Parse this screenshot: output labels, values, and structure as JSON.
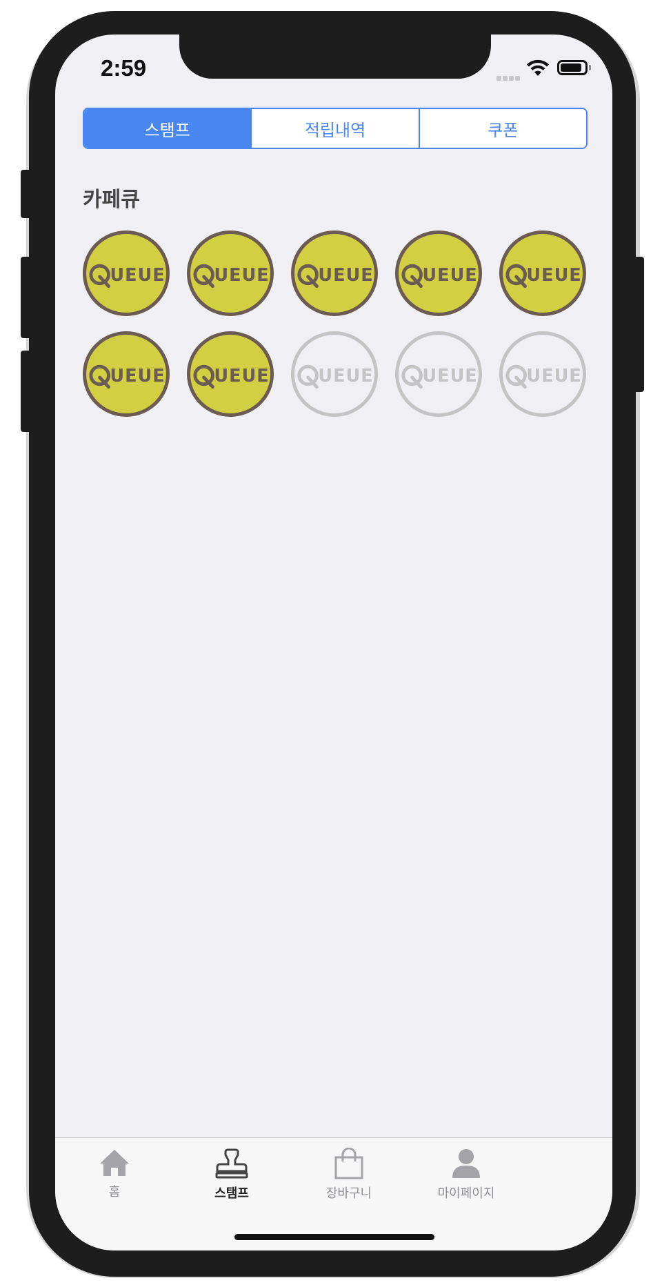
{
  "status_bar": {
    "time": "2:59"
  },
  "segmented": {
    "tabs": [
      {
        "label": "스탬프",
        "active": true
      },
      {
        "label": "적립내역",
        "active": false
      },
      {
        "label": "쿠폰",
        "active": false
      }
    ]
  },
  "store": {
    "name": "카페큐"
  },
  "stamps": {
    "logo_text": "QUEUE",
    "total": 10,
    "collected": 7,
    "filled_color": "#d2cf42",
    "outline_color": "#6b5b52",
    "empty_color": "#c4c4c4"
  },
  "tabbar": {
    "items": [
      {
        "label": "홈",
        "icon": "home-icon"
      },
      {
        "label": "스탬프",
        "icon": "stamp-icon",
        "active": true
      },
      {
        "label": "장바구니",
        "icon": "shopping-bag-icon"
      },
      {
        "label": "마이페이지",
        "icon": "person-icon"
      }
    ]
  },
  "accent_color": "#4a86f0"
}
